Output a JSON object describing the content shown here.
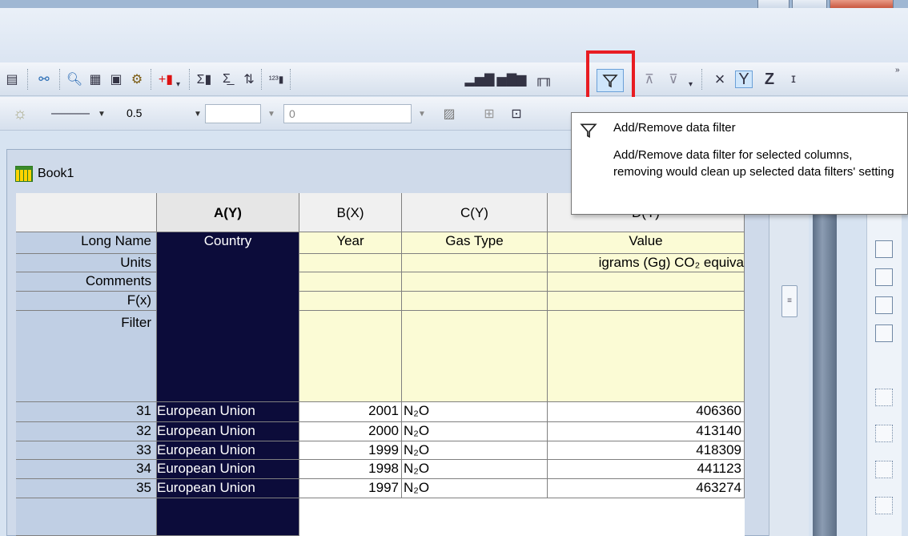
{
  "toolbar2": {
    "line_width": "0.5",
    "number_value": "0"
  },
  "workbook": {
    "title": "Book1",
    "columns": [
      "A(Y)",
      "B(X)",
      "C(Y)",
      "D(Y)"
    ],
    "row_labels": [
      "Long Name",
      "Units",
      "Comments",
      "F(x)",
      "Filter"
    ],
    "long_names": [
      "Country",
      "Year",
      "Gas Type",
      "Value"
    ],
    "units_d": "igrams (Gg) CO₂ equiva",
    "rows": [
      {
        "index": "31",
        "country": "European Union",
        "year": "2001",
        "gas": "N₂O",
        "value": "406360"
      },
      {
        "index": "32",
        "country": "European Union",
        "year": "2000",
        "gas": "N₂O",
        "value": "413140"
      },
      {
        "index": "33",
        "country": "European Union",
        "year": "1999",
        "gas": "N₂O",
        "value": "418309"
      },
      {
        "index": "34",
        "country": "European Union",
        "year": "1998",
        "gas": "N₂O",
        "value": "441123"
      },
      {
        "index": "35",
        "country": "European Union",
        "year": "1997",
        "gas": "N₂O",
        "value": "463274"
      }
    ]
  },
  "tooltip": {
    "title": "Add/Remove data filter",
    "description": "Add/Remove data filter for selected columns, removing would clean up selected data filters' setting"
  },
  "colors": {
    "highlight": "#e81c22",
    "selected_column": "#0c0c3a",
    "label_column": "#c0cfe4",
    "header_yellow": "#fbfbd5"
  }
}
